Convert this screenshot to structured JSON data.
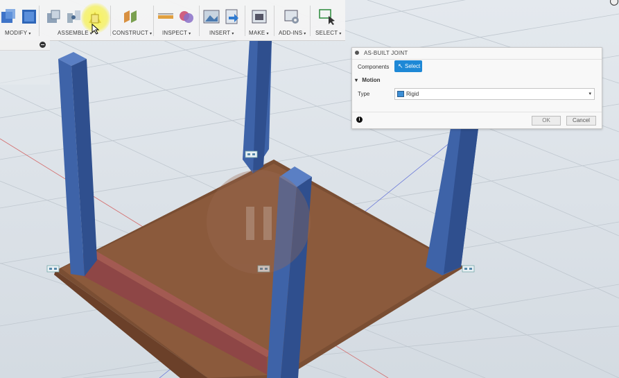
{
  "toolbar": {
    "groups": [
      {
        "label": "MODIFY"
      },
      {
        "label": "ASSEMBLE"
      },
      {
        "label": "CONSTRUCT"
      },
      {
        "label": "INSPECT"
      },
      {
        "label": "INSERT"
      },
      {
        "label": "MAKE"
      },
      {
        "label": "ADD-INS"
      },
      {
        "label": "SELECT"
      }
    ],
    "caret": "▾"
  },
  "dialog": {
    "title": "AS-BUILT JOINT",
    "components_label": "Components",
    "select_label": "Select",
    "motion_label": "Motion",
    "type_label": "Type",
    "type_value": "Rigid",
    "ok_label": "OK",
    "cancel_label": "Cancel",
    "info_glyph": "i"
  },
  "colors": {
    "accent": "#1e88d6",
    "leg": "#3b5f9e",
    "tabletop": "#8a5a3c",
    "apron": "#8e4646"
  },
  "icons": {
    "select_cursor": "↖",
    "motion_triangle": "▾",
    "dropdown": "▾"
  }
}
